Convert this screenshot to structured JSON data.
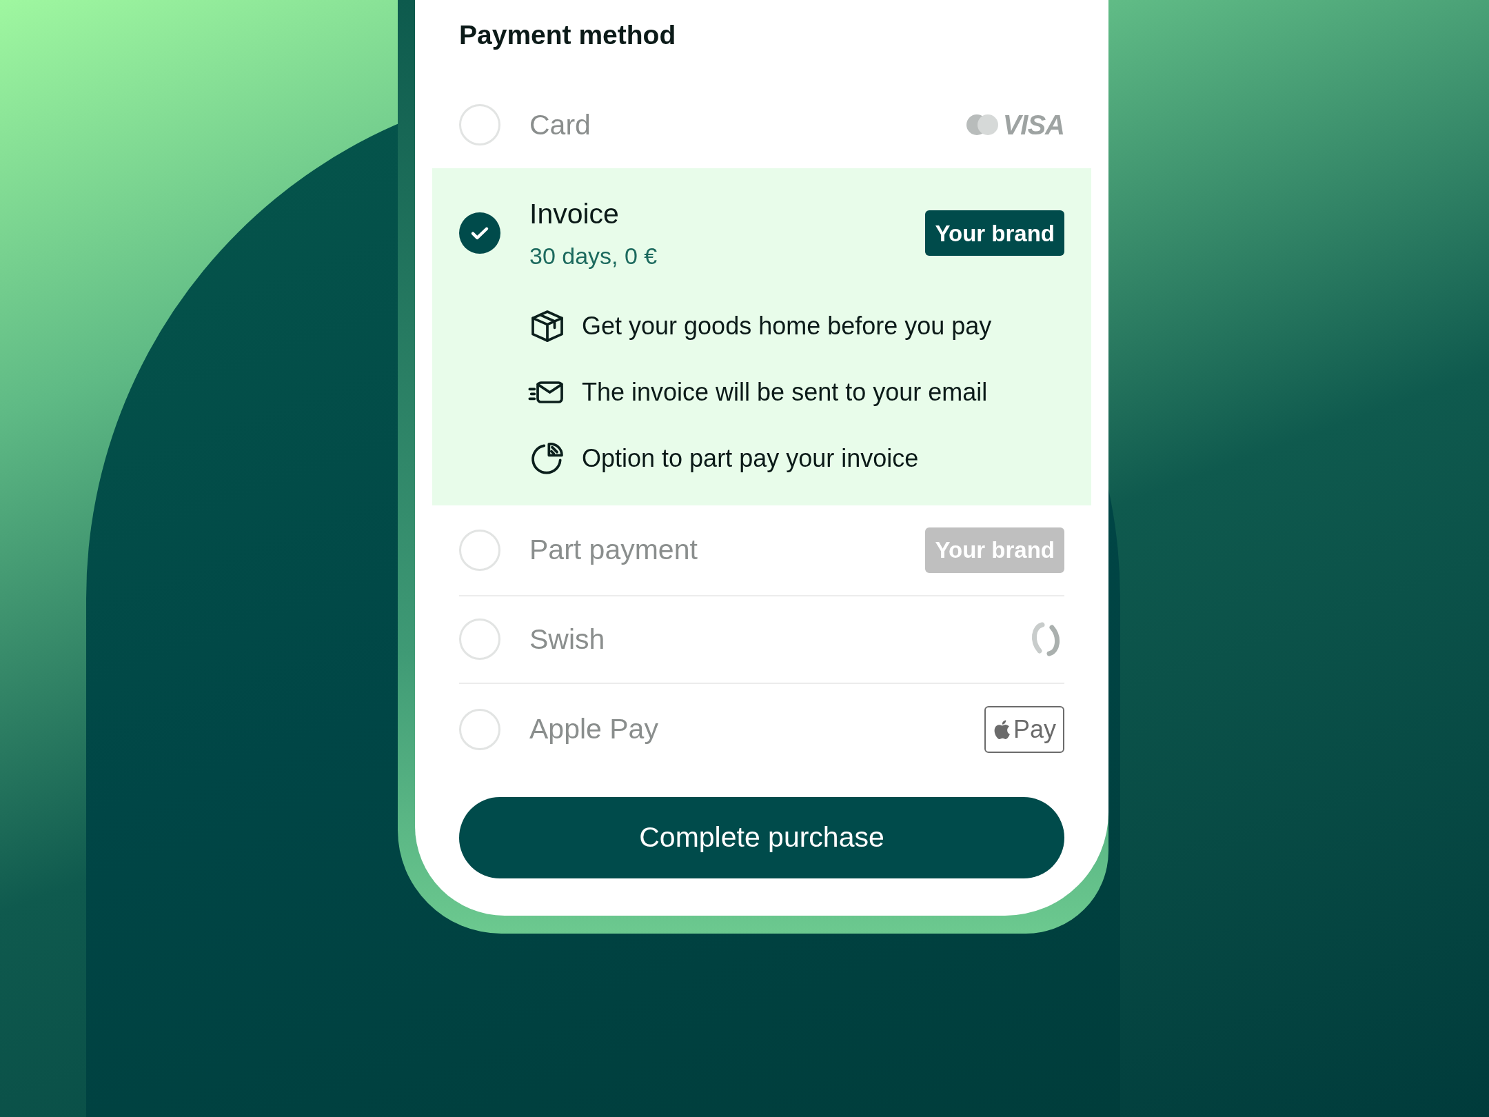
{
  "title": "Payment method",
  "methods": [
    {
      "label": "Card",
      "selected": false,
      "logo": {
        "kind": "visa",
        "text": "VISA"
      }
    },
    {
      "label": "Invoice",
      "selected": true,
      "subtitle": "30 days, 0 €",
      "logo": {
        "kind": "brand",
        "text": "Your brand"
      },
      "features": [
        {
          "kind": "box",
          "text": "Get your goods home before you pay"
        },
        {
          "kind": "mail",
          "text": "The invoice will be sent to your email"
        },
        {
          "kind": "pie",
          "text": "Option to part pay your invoice"
        }
      ]
    },
    {
      "label": "Part payment",
      "selected": false,
      "logo": {
        "kind": "brand",
        "text": "Your brand"
      }
    },
    {
      "label": "Swish",
      "selected": false,
      "logo": {
        "kind": "swish"
      }
    },
    {
      "label": "Apple Pay",
      "selected": false,
      "logo": {
        "kind": "applepay",
        "text": "Pay"
      }
    }
  ],
  "button": "Complete purchase"
}
